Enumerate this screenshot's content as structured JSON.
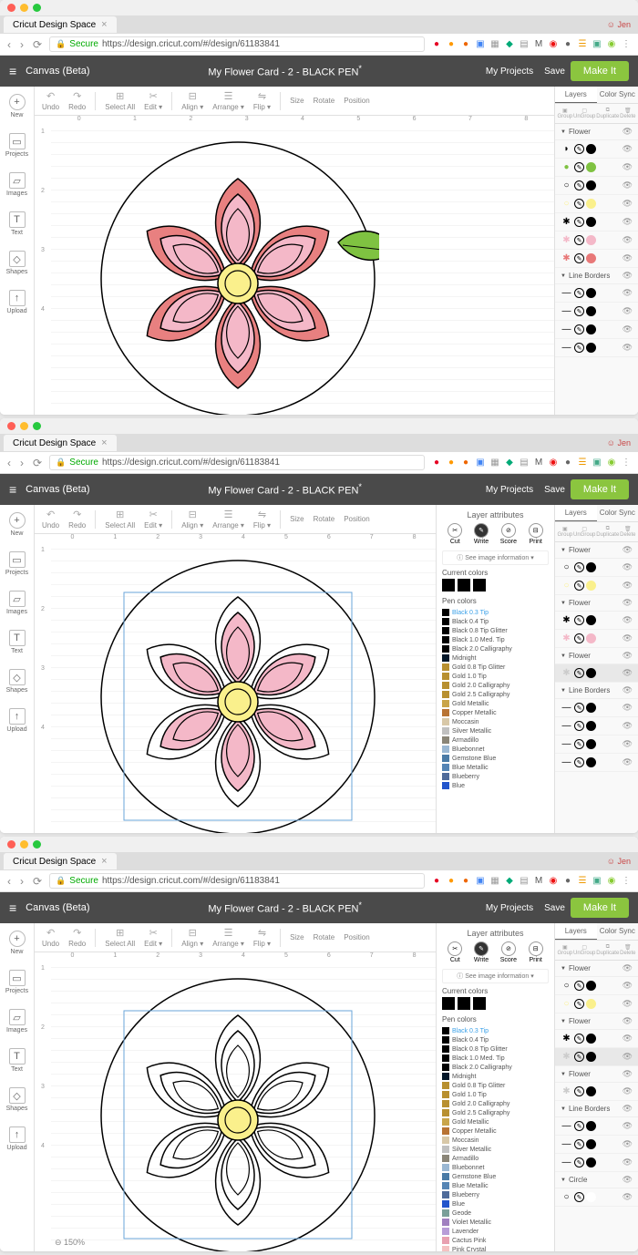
{
  "browser": {
    "title": "Cricut Design Space",
    "url": "design.cricut.com/#/design/61183841",
    "secure": "Secure",
    "https": "https://",
    "profile": "Jen"
  },
  "app": {
    "canvas": "Canvas (Beta)",
    "title": "My Flower Card - 2 - BLACK PEN",
    "sup": "*",
    "myprojects": "My Projects",
    "save": "Save",
    "makeit": "Make It"
  },
  "left": [
    {
      "l": "New",
      "ico": "+"
    },
    {
      "l": "Projects",
      "ico": "▭"
    },
    {
      "l": "Images",
      "ico": "▱"
    },
    {
      "l": "Text",
      "ico": "T"
    },
    {
      "l": "Shapes",
      "ico": "◇"
    },
    {
      "l": "Upload",
      "ico": "↑"
    }
  ],
  "tb": {
    "undo": "Undo",
    "redo": "Redo",
    "selectall": "Select All",
    "edit": "Edit",
    "align": "Align",
    "arrange": "Arrange",
    "flip": "Flip",
    "size": "Size",
    "rotate": "Rotate",
    "position": "Position"
  },
  "rtabs": {
    "layers": "Layers",
    "colorsync": "Color Sync"
  },
  "ract": {
    "group": "Group",
    "ungroup": "UnGroup",
    "duplicate": "Duplicate",
    "delete": "Delete"
  },
  "attr": {
    "header": "Layer attributes",
    "cut": "Cut",
    "write": "Write",
    "score": "Score",
    "print": "Print",
    "seeinfo": "See image information",
    "currentcolors": "Current colors",
    "pencolors": "Pen colors"
  },
  "pens": [
    {
      "c": "#000",
      "n": "Black 0.3 Tip"
    },
    {
      "c": "#000",
      "n": "Black 0.4 Tip"
    },
    {
      "c": "#000",
      "n": "Black 0.8 Tip Glitter"
    },
    {
      "c": "#000",
      "n": "Black 1.0 Med. Tip"
    },
    {
      "c": "#000",
      "n": "Black 2.0 Calligraphy"
    },
    {
      "c": "#05182a",
      "n": "Midnight"
    },
    {
      "c": "#b89030",
      "n": "Gold 0.8 Tip Glitter"
    },
    {
      "c": "#b89030",
      "n": "Gold 1.0 Tip"
    },
    {
      "c": "#b89030",
      "n": "Gold 2.0 Calligraphy"
    },
    {
      "c": "#b89030",
      "n": "Gold 2.5 Calligraphy"
    },
    {
      "c": "#c9a54a",
      "n": "Gold Metallic"
    },
    {
      "c": "#b87333",
      "n": "Copper Metallic"
    },
    {
      "c": "#d8c8a8",
      "n": "Moccasin"
    },
    {
      "c": "#c0c0c0",
      "n": "Silver Metallic"
    },
    {
      "c": "#8a8577",
      "n": "Armadillo"
    },
    {
      "c": "#9bb8d3",
      "n": "Bluebonnet"
    },
    {
      "c": "#4a7ba6",
      "n": "Gemstone Blue"
    },
    {
      "c": "#5585b5",
      "n": "Blue Metallic"
    },
    {
      "c": "#4f6b9a",
      "n": "Blueberry"
    },
    {
      "c": "#2255cc",
      "n": "Blue"
    }
  ],
  "pens3": [
    {
      "c": "#000",
      "n": "Black 0.3 Tip"
    },
    {
      "c": "#000",
      "n": "Black 0.4 Tip"
    },
    {
      "c": "#000",
      "n": "Black 0.8 Tip Glitter"
    },
    {
      "c": "#000",
      "n": "Black 1.0 Med. Tip"
    },
    {
      "c": "#000",
      "n": "Black 2.0 Calligraphy"
    },
    {
      "c": "#05182a",
      "n": "Midnight"
    },
    {
      "c": "#b89030",
      "n": "Gold 0.8 Tip Glitter"
    },
    {
      "c": "#b89030",
      "n": "Gold 1.0 Tip"
    },
    {
      "c": "#b89030",
      "n": "Gold 2.0 Calligraphy"
    },
    {
      "c": "#b89030",
      "n": "Gold 2.5 Calligraphy"
    },
    {
      "c": "#c9a54a",
      "n": "Gold Metallic"
    },
    {
      "c": "#b87333",
      "n": "Copper Metallic"
    },
    {
      "c": "#d8c8a8",
      "n": "Moccasin"
    },
    {
      "c": "#c0c0c0",
      "n": "Silver Metallic"
    },
    {
      "c": "#8a8577",
      "n": "Armadillo"
    },
    {
      "c": "#9bb8d3",
      "n": "Bluebonnet"
    },
    {
      "c": "#4a7ba6",
      "n": "Gemstone Blue"
    },
    {
      "c": "#5585b5",
      "n": "Blue Metallic"
    },
    {
      "c": "#4f6b9a",
      "n": "Blueberry"
    },
    {
      "c": "#2255cc",
      "n": "Blue"
    },
    {
      "c": "#7aa099",
      "n": "Geode"
    },
    {
      "c": "#a080c0",
      "n": "Violet Metallic"
    },
    {
      "c": "#b89dd8",
      "n": "Lavender"
    },
    {
      "c": "#e8a0b0",
      "n": "Cactus Pink"
    },
    {
      "c": "#f4c2c2",
      "n": "Pink Crystal"
    }
  ],
  "layers1": {
    "groups": [
      {
        "name": "Flower",
        "items": [
          {
            "th": "leaf",
            "c1": "#000",
            "c2": "#000"
          },
          {
            "th": "dot",
            "tc": "#7fc241",
            "c1": "#000",
            "c2": "#7fc241"
          },
          {
            "th": "circ",
            "c1": "#000",
            "c2": "#000"
          },
          {
            "th": "circ",
            "tc": "#faf08c",
            "c1": "#faf08c",
            "c2": "#faf08c"
          },
          {
            "th": "flower",
            "c1": "#000",
            "c2": "#000"
          },
          {
            "th": "flower",
            "tc": "#f4b8c8",
            "c1": "#000",
            "c2": "#f4b8c8"
          },
          {
            "th": "flower",
            "tc": "#e87878",
            "c1": "#000",
            "c2": "#e87878"
          }
        ]
      },
      {
        "name": "Line Borders",
        "items": [
          {
            "th": "line",
            "c1": "#000",
            "c2": "#000"
          },
          {
            "th": "line",
            "c1": "#000",
            "c2": "#000"
          },
          {
            "th": "line",
            "c1": "#000",
            "c2": "#000"
          },
          {
            "th": "line",
            "c1": "#000",
            "c2": "#000"
          }
        ]
      }
    ]
  },
  "layers2": {
    "groups": [
      {
        "name": "Flower",
        "items": [
          {
            "th": "circ",
            "c1": "#000",
            "c2": "#000"
          },
          {
            "th": "circ",
            "tc": "#faf08c",
            "c1": "#faf08c",
            "c2": "#faf08c"
          }
        ]
      },
      {
        "name": "Flower",
        "items": [
          {
            "th": "flower",
            "c1": "#000",
            "c2": "#000"
          },
          {
            "th": "flower",
            "tc": "#f4b8c8",
            "c1": "#000",
            "c2": "#f4b8c8"
          }
        ]
      },
      {
        "name": "Flower",
        "items": [
          {
            "th": "flower",
            "tc": "#ccc",
            "c1": "#000",
            "c2": "#000",
            "sel": true
          }
        ]
      },
      {
        "name": "Line Borders",
        "items": [
          {
            "th": "line",
            "c1": "#000",
            "c2": "#000"
          },
          {
            "th": "line",
            "c1": "#000",
            "c2": "#000"
          },
          {
            "th": "line",
            "c1": "#000",
            "c2": "#000"
          },
          {
            "th": "line",
            "c1": "#000",
            "c2": "#000"
          }
        ]
      }
    ]
  },
  "layers3": {
    "groups": [
      {
        "name": "Flower",
        "items": [
          {
            "th": "circ",
            "c1": "#000",
            "c2": "#000"
          },
          {
            "th": "circ",
            "tc": "#faf08c",
            "c1": "#faf08c",
            "c2": "#faf08c"
          }
        ]
      },
      {
        "name": "Flower",
        "items": [
          {
            "th": "flower",
            "c1": "#000",
            "c2": "#000"
          },
          {
            "th": "flower",
            "tc": "#ccc",
            "c1": "#000",
            "c2": "#000",
            "sel": true
          }
        ]
      },
      {
        "name": "Flower",
        "items": [
          {
            "th": "flower",
            "tc": "#ccc",
            "c1": "#000",
            "c2": "#000"
          }
        ]
      },
      {
        "name": "Line Borders",
        "items": [
          {
            "th": "line",
            "c1": "#000",
            "c2": "#000"
          },
          {
            "th": "line",
            "c1": "#000",
            "c2": "#000"
          },
          {
            "th": "line",
            "c1": "#000",
            "c2": "#000"
          }
        ]
      },
      {
        "name": "Circle",
        "items": [
          {
            "th": "circ",
            "c1": "#fff",
            "c2": "#fff"
          }
        ]
      }
    ]
  },
  "zoom": "150%"
}
